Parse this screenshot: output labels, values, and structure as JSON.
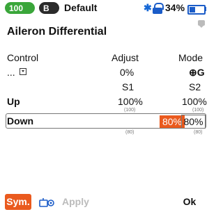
{
  "status": {
    "pill_green_text": "100",
    "pill_dark_text": "B",
    "model_name": "Default",
    "battery_percent": "34%",
    "bluetooth_icon": "bluetooth-icon",
    "lock_icon": "lock-icon"
  },
  "page": {
    "title": "Aileron Differential"
  },
  "columns": {
    "control": "Control",
    "adjust": "Adjust",
    "mode": "Mode"
  },
  "values": {
    "control_value": "...",
    "adjust_value": "0%",
    "mode_value": "⊕G"
  },
  "channels": {
    "s1": "S1",
    "s2": "S2"
  },
  "rows": [
    {
      "label": "Up",
      "s1": "100%",
      "s2": "100%",
      "s1_small": "(100)",
      "s2_small": "(100)"
    },
    {
      "label": "Down",
      "s1": "80%",
      "s2": "80%",
      "s1_small": "(80)",
      "s2_small": "(80)"
    }
  ],
  "footer": {
    "sym": "Sym.",
    "apply": "Apply",
    "ok": "Ok"
  }
}
